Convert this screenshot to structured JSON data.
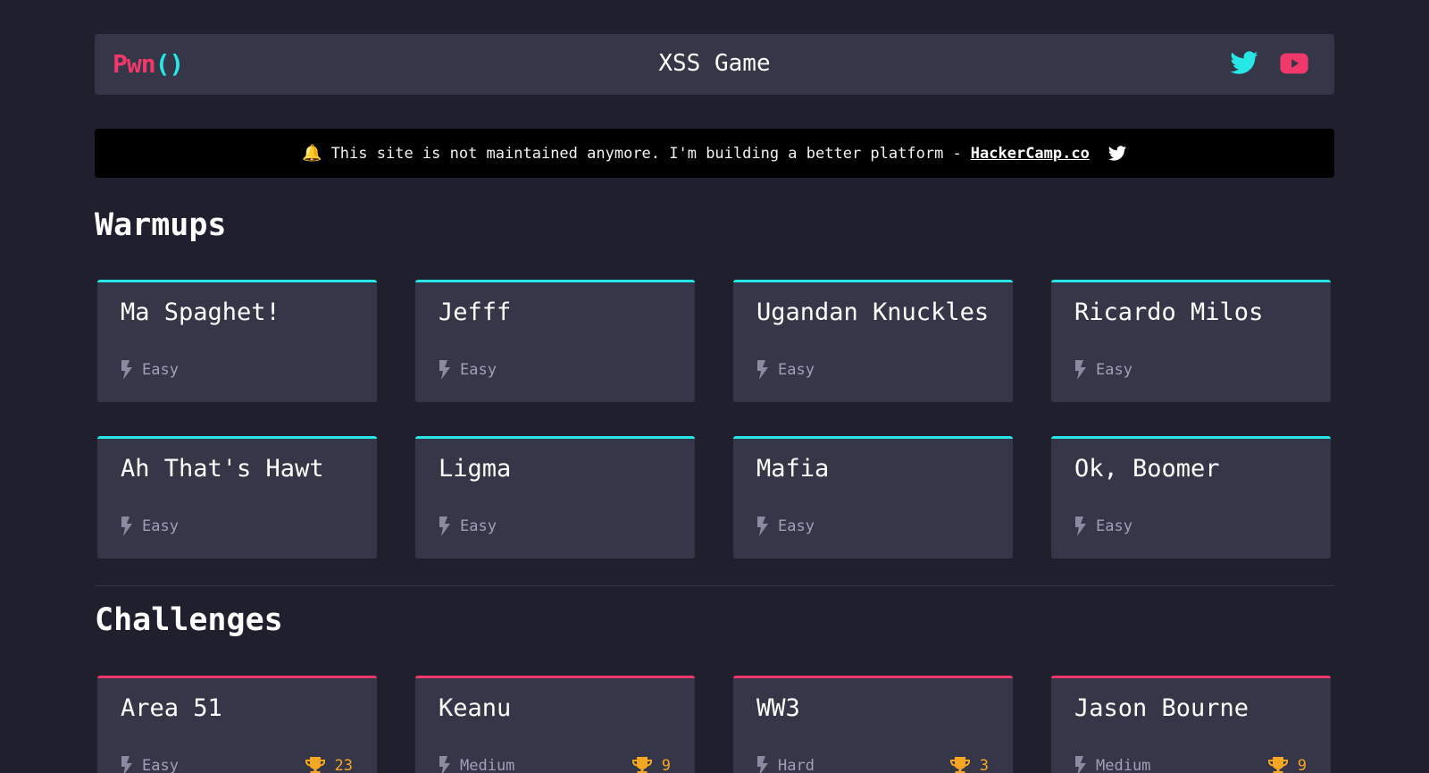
{
  "header": {
    "logo_pwn": "Pwn",
    "logo_paren": "()",
    "title": "XSS Game",
    "social": [
      {
        "icon": "twitter-icon",
        "color": "#27e6e6"
      },
      {
        "icon": "youtube-icon",
        "color": "#f0386b"
      }
    ]
  },
  "notice": {
    "bell_icon": "bell-icon",
    "text": "This site is not maintained anymore. I'm building a better platform -",
    "link_text": "HackerCamp.co",
    "twitter_icon": "twitter-icon"
  },
  "warmups": {
    "title": "Warmups",
    "accent": "#27e6e6",
    "cards": [
      {
        "name": "Ma Spaghet!",
        "difficulty": "Easy"
      },
      {
        "name": "Jefff",
        "difficulty": "Easy"
      },
      {
        "name": "Ugandan Knuckles",
        "difficulty": "Easy"
      },
      {
        "name": "Ricardo Milos",
        "difficulty": "Easy"
      },
      {
        "name": "Ah That's Hawt",
        "difficulty": "Easy"
      },
      {
        "name": "Ligma",
        "difficulty": "Easy"
      },
      {
        "name": "Mafia",
        "difficulty": "Easy"
      },
      {
        "name": "Ok, Boomer",
        "difficulty": "Easy"
      }
    ]
  },
  "challenges": {
    "title": "Challenges",
    "accent": "#f0386b",
    "cards": [
      {
        "name": "Area 51",
        "difficulty": "Easy",
        "solves": "23"
      },
      {
        "name": "Keanu",
        "difficulty": "Medium",
        "solves": "9"
      },
      {
        "name": "WW3",
        "difficulty": "Hard",
        "solves": "3"
      },
      {
        "name": "Jason Bourne",
        "difficulty": "Medium",
        "solves": "9"
      }
    ]
  },
  "colors": {
    "background": "#1f1f2e",
    "card": "#363649",
    "cyan": "#27e6e6",
    "pink": "#f0386b",
    "gold": "#f5a623"
  }
}
